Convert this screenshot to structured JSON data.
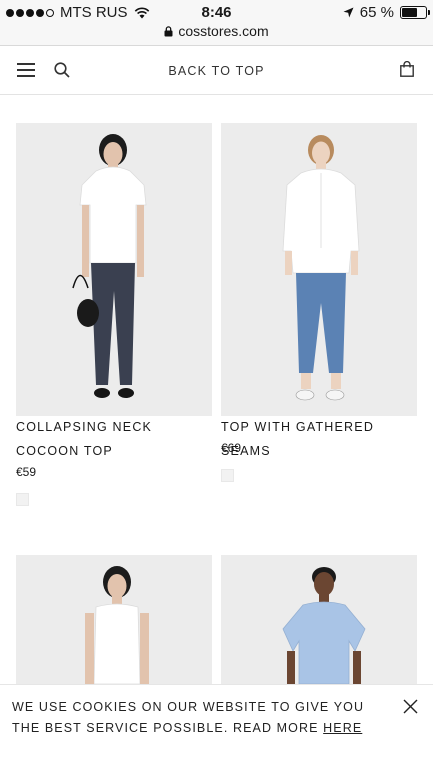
{
  "status_bar": {
    "carrier": "MTS RUS",
    "time": "8:46",
    "battery_text": "65 %",
    "battery_level": 0.65,
    "signal_bars_filled": 4,
    "signal_bars_total": 5,
    "url": "cosstores.com",
    "icons": [
      "wifi-icon",
      "lock-icon",
      "location-arrow-icon",
      "battery-icon"
    ]
  },
  "header": {
    "back_to_top": "BACK TO TOP",
    "icons": [
      "menu-icon",
      "search-icon",
      "shopping-bag-icon"
    ]
  },
  "products": [
    {
      "title_line1": "COLLAPSING NECK",
      "title_line2": "COCOON TOP",
      "price": "€59",
      "swatch_color": "#f2f2f2"
    },
    {
      "title_line1": "TOP WITH GATHERED SEAMS",
      "title_line2": "",
      "price": "€69",
      "swatch_color": "#f2f2f2"
    },
    {
      "title_line1": "",
      "title_line2": "",
      "price": ""
    },
    {
      "title_line1": "",
      "title_line2": "",
      "price": ""
    }
  ],
  "cookie_banner": {
    "text_line1": "WE USE COOKIES ON OUR WEBSITE TO GIVE YOU",
    "text_line2_prefix": "THE BEST SERVICE POSSIBLE. READ MORE ",
    "link_text": "HERE"
  },
  "colors": {
    "image_bg": "#ececec",
    "text": "#1a1a1a"
  }
}
